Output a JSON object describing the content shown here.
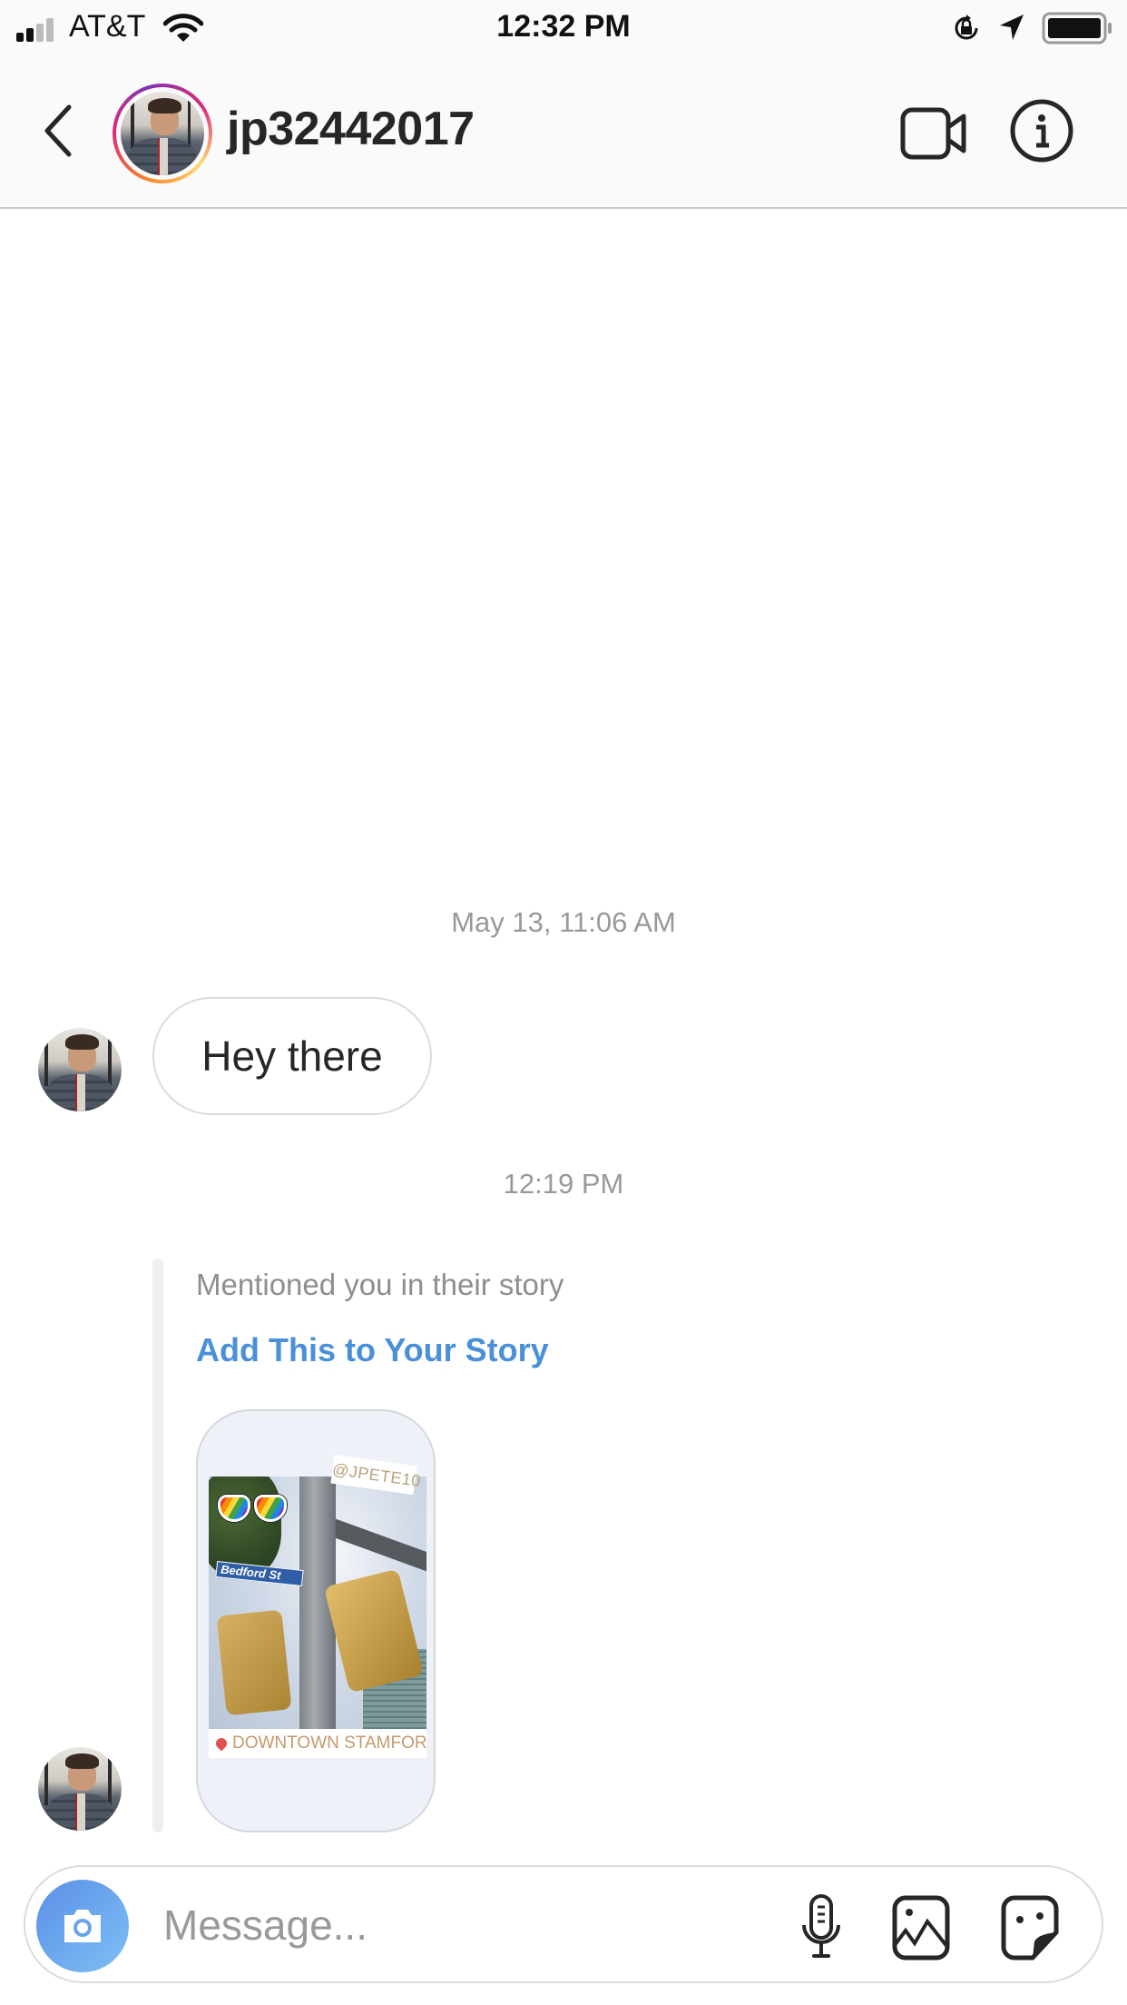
{
  "status_bar": {
    "carrier": "AT&T",
    "time": "12:32 PM",
    "icons": [
      "signal-icon",
      "wifi-icon",
      "orientation-lock-icon",
      "location-arrow-icon",
      "battery-icon"
    ]
  },
  "header": {
    "back_icon": "chevron-left-icon",
    "username": "jp32442017",
    "video_call_icon": "video-camera-icon",
    "info_icon": "info-icon",
    "story_ring_colors": [
      "#f58529",
      "#dd2a7b",
      "#8134af"
    ]
  },
  "thread": {
    "timestamps": [
      "May 13, 11:06 AM",
      "12:19 PM"
    ],
    "messages": [
      {
        "type": "text",
        "sender": "jp32442017",
        "text": "Hey there"
      },
      {
        "type": "story_mention",
        "sender": "jp32442017",
        "caption": "Mentioned you in their story",
        "action_label": "Add This to Your Story",
        "story": {
          "mention_sticker": "@JPETE10",
          "location_sticker": "DOWNTOWN STAMFORD",
          "street_sign": "Bedford St"
        }
      }
    ]
  },
  "composer": {
    "placeholder": "Message...",
    "value": "",
    "icons": [
      "camera-icon",
      "microphone-icon",
      "gallery-icon",
      "sticker-icon"
    ]
  },
  "colors": {
    "link_blue": "#4a90d9",
    "timestamp_gray": "#999999",
    "camera_button": "#5b8fe6"
  }
}
